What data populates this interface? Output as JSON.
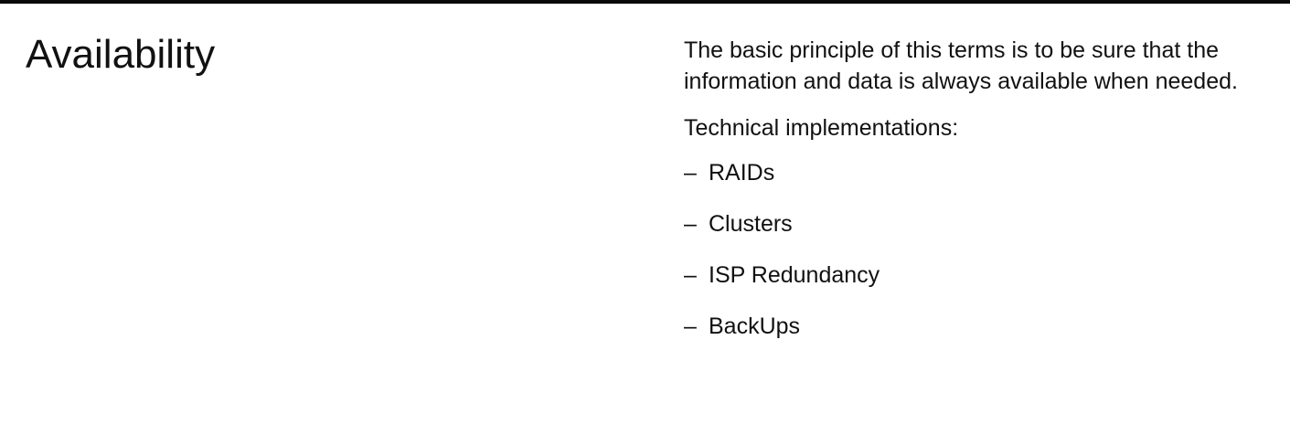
{
  "slide": {
    "title": "Availability",
    "intro": "The basic principle of this terms is to be sure that the information and data is always available when needed.",
    "subheading": "Technical implementations:",
    "bullet_marker": "–",
    "bullets": [
      "RAIDs",
      "Clusters",
      "ISP Redundancy",
      "BackUps"
    ]
  }
}
